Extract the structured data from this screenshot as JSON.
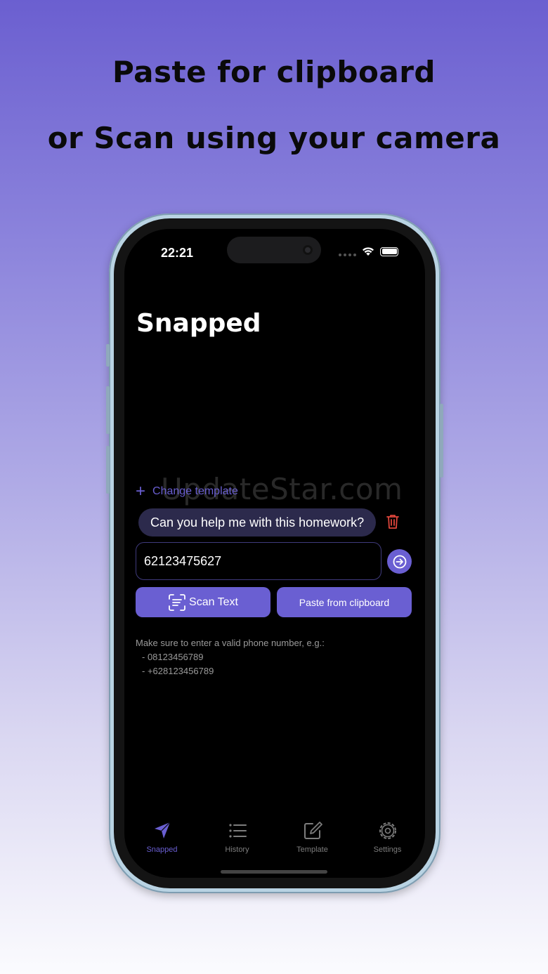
{
  "promo": {
    "line1": "Paste for clipboard",
    "line2": "or Scan using your camera"
  },
  "status_bar": {
    "time": "22:21"
  },
  "page": {
    "title": "Snapped"
  },
  "watermark": "UpdateStar.com",
  "template": {
    "change_label": "Change template",
    "message": "Can you help me with this homework?"
  },
  "phone_input": {
    "value": "62123475627"
  },
  "actions": {
    "scan_label": "Scan Text",
    "paste_label": "Paste from clipboard"
  },
  "help": {
    "intro": "Make sure to enter a valid phone number, e.g.:",
    "examples": [
      "- 08123456789",
      "- +628123456789"
    ]
  },
  "tabs": [
    {
      "label": "Snapped",
      "icon": "send-icon",
      "active": true
    },
    {
      "label": "History",
      "icon": "list-icon",
      "active": false
    },
    {
      "label": "Template",
      "icon": "compose-icon",
      "active": false
    },
    {
      "label": "Settings",
      "icon": "gear-icon",
      "active": false
    }
  ],
  "colors": {
    "accent": "#6a5fd2",
    "bubble": "#2c2a4c",
    "delete": "#e0463c"
  }
}
